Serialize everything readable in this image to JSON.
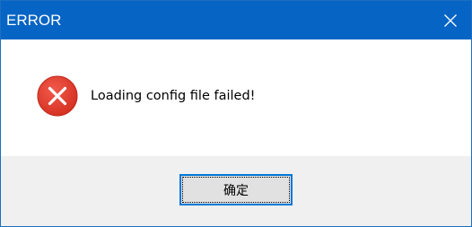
{
  "window": {
    "title": "ERROR"
  },
  "dialog": {
    "message": "Loading config file failed!",
    "ok_label": "确定"
  },
  "icons": {
    "close": "close-icon",
    "error": "error-icon"
  },
  "colors": {
    "titlebar": "#0664c4",
    "error_red": "#e81123",
    "button_focus_border": "#0078d7"
  }
}
